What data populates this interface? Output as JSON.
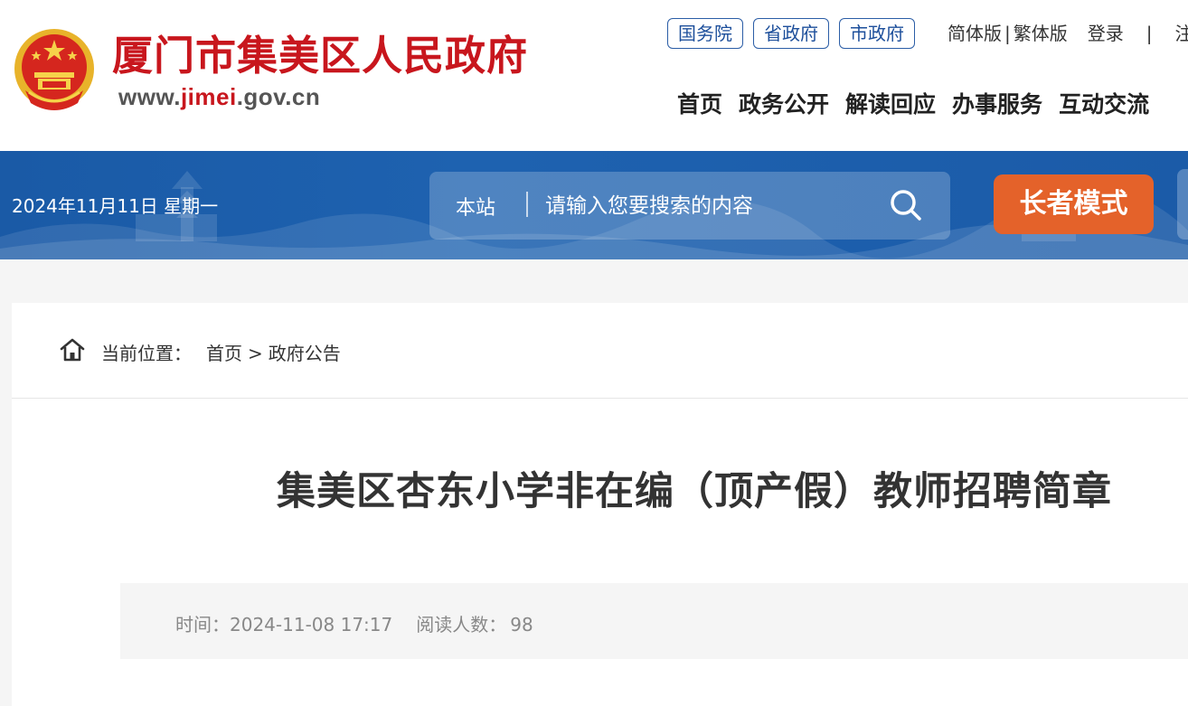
{
  "header": {
    "site_title": "厦门市集美区人民政府",
    "url_prefix": "www.",
    "url_highlight": "jimei",
    "url_suffix": ".gov.cn",
    "gov_links": [
      "国务院",
      "省政府",
      "市政府"
    ],
    "simplified": "简体版",
    "sep": "|",
    "traditional": "繁体版",
    "login": "登录",
    "register": "注",
    "nav": [
      "首页",
      "政务公开",
      "解读回应",
      "办事服务",
      "互动交流"
    ]
  },
  "banner": {
    "date": "2024年11月11日 星期一",
    "search_scope": "本站",
    "search_placeholder": "请输入您要搜索的内容",
    "elder_mode": "长者模式"
  },
  "breadcrumb": {
    "prefix": "当前位置：",
    "home": "首页",
    "arrow": ">",
    "current": "政府公告"
  },
  "article": {
    "title": "集美区杏东小学非在编（顶产假）教师招聘简章",
    "time_label": "时间：",
    "time_value": "2024-11-08 17:17",
    "views_label": "阅读人数：",
    "views_value": "98"
  },
  "colors": {
    "brand_red": "#c8161d",
    "banner_blue": "#1e62b0",
    "elder_orange": "#e4622a",
    "link_blue": "#1d4f9b"
  }
}
